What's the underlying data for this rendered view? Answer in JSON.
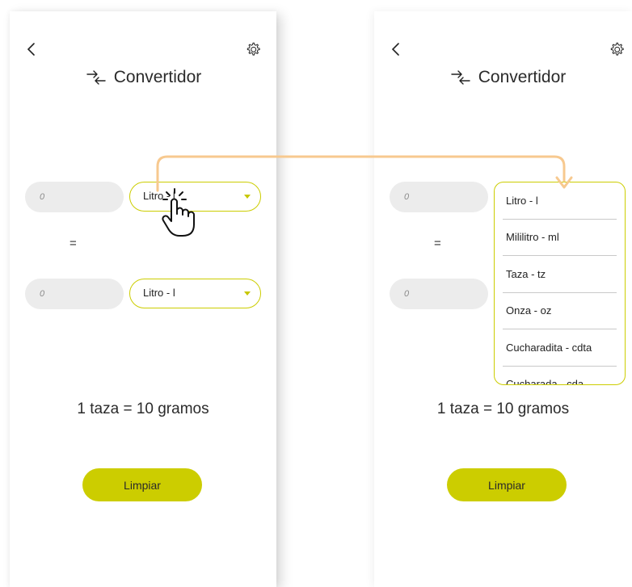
{
  "screens": [
    {
      "title": "Convertidor",
      "input_top": "0",
      "select_top": "Litro - l",
      "equals": "=",
      "input_bottom": "0",
      "select_bottom": "Litro - l",
      "result": "1 taza = 10 gramos",
      "clear_label": "Limpiar"
    },
    {
      "title": "Convertidor",
      "input_top": "0",
      "equals": "=",
      "input_bottom": "0",
      "result": "1 taza = 10 gramos",
      "clear_label": "Limpiar",
      "dropdown_options": [
        "Litro - l",
        "Mililitro - ml",
        "Taza - tz",
        "Onza - oz",
        "Cucharadita - cdta",
        "Cucharada - cda"
      ]
    }
  ],
  "icons": {
    "back": "chevron-left-icon",
    "settings": "gear-icon",
    "title": "swap-arrows-icon",
    "pointer": "hand-pointer-icon"
  },
  "colors": {
    "accent": "#cccd00",
    "annotation_arrow": "#f7c98f",
    "input_bg": "#ececec"
  }
}
